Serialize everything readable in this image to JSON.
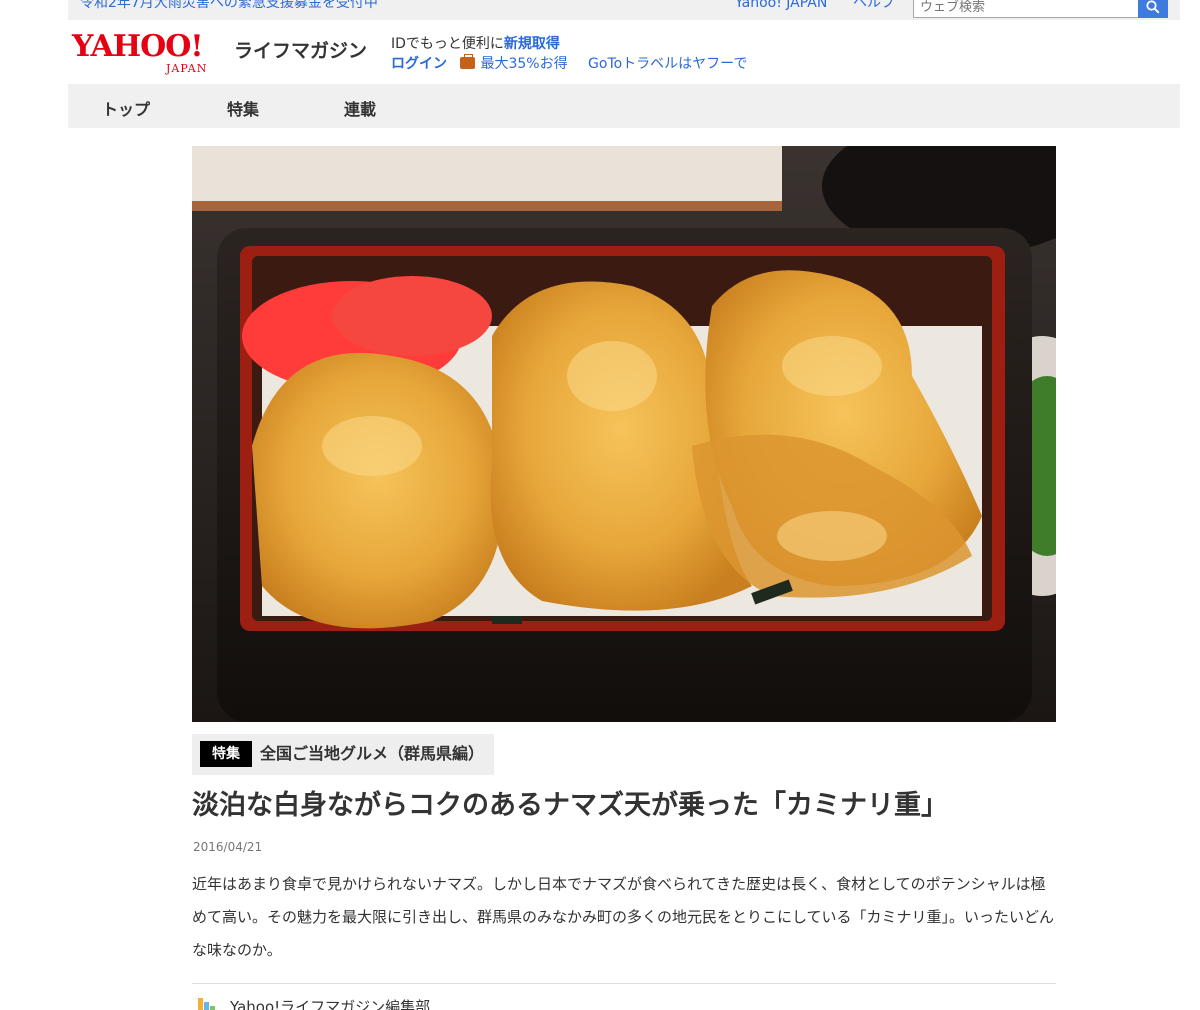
{
  "topbar": {
    "notice": "令和2年7月大雨災害への緊急支援募金を受付中",
    "yahoo_japan_link": "Yahoo! JAPAN",
    "help_link": "ヘルプ",
    "search_placeholder": "ウェブ検索"
  },
  "header": {
    "logo_main": "YAHOO!",
    "logo_sub": "JAPAN",
    "brand": "ライフマガジン",
    "id_text": "IDでもっと便利に",
    "id_register": "新規取得",
    "login": "ログイン",
    "promo": "最大35%お得",
    "goto_travel": "GoToトラベルはヤフーで"
  },
  "nav": {
    "items": [
      {
        "label": "トップ"
      },
      {
        "label": "特集"
      },
      {
        "label": "連載"
      }
    ]
  },
  "hero": {
    "description_icon": "photo-image"
  },
  "article": {
    "tag": "特集",
    "series": "全国ご当地グルメ（群馬県編）",
    "title": "淡泊な白身ながらコクのあるナマズ天が乗った「カミナリ重」",
    "date": "2016/04/21",
    "lead": "近年はあまり食卓で見かけられないナマズ。しかし日本でナマズが食べられてきた歴史は長く、食材としてのポテンシャルは極めて高い。その魅力を最大限に引き出し、群馬県のみなかみ町の多くの地元民をとりこにしている「カミナリ重」。いったいどんな味なのか。",
    "author": "Yahoo!ライフマガジン編集部"
  },
  "colors": {
    "link": "#2a6ad9",
    "brand_red": "#e60012",
    "search_button": "#3d7bdf",
    "nav_bg": "#f0f0f0"
  }
}
